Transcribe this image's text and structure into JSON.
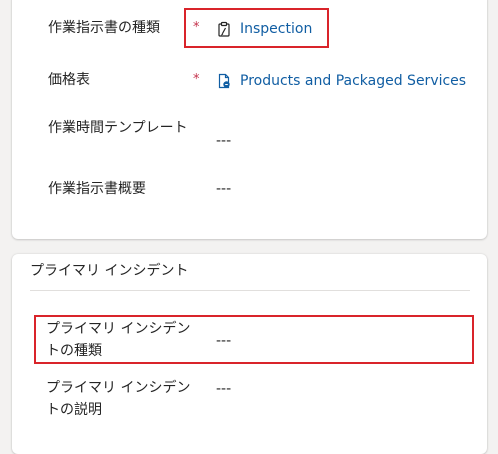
{
  "top_card": {
    "fields": [
      {
        "label": "作業指示書の種類",
        "required_mark": "*",
        "value": "Inspection",
        "value_icon": "clipboard-icon"
      },
      {
        "label": "価格表",
        "required_mark": "*",
        "value": "Products and Packaged Services",
        "value_icon": "price-list-icon"
      },
      {
        "label": "作業時間テンプレート",
        "value": "---"
      },
      {
        "label": "作業指示書概要",
        "value": "---"
      }
    ]
  },
  "primary_incident": {
    "section_title": "プライマリ インシデント",
    "fields": [
      {
        "label": "プライマリ インシデントの種類",
        "value": "---"
      },
      {
        "label": "プライマリ インシデントの説明",
        "value": "---"
      }
    ]
  },
  "colors": {
    "link": "#115ea3",
    "required": "#c4314b",
    "highlight": "#d9242a",
    "page_background": "#f3f2f1"
  }
}
